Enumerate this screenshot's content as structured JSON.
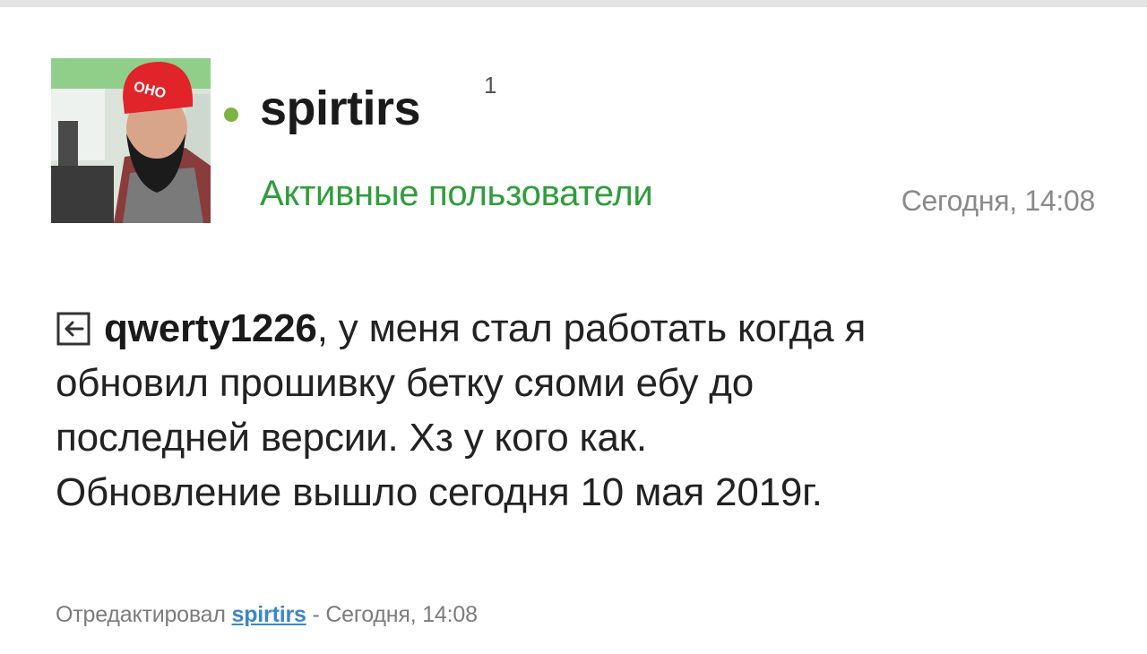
{
  "post": {
    "author": {
      "username": "spirtirs",
      "reputation": "1",
      "group": "Активные пользователи",
      "online": true,
      "avatar_hat_text": "OHO"
    },
    "timestamp": "Сегодня, 14:08",
    "body": {
      "mention": "qwerty1226",
      "line1_rest": ", у меня стал работать когда я",
      "line2": "обновил прошивку бетку сяоми ебу до",
      "line3": "последней версии. Хз у кого как.",
      "line4": "Обновление вышло сегодня 10 мая 2019г."
    },
    "edit_note": {
      "prefix": "Отредактировал",
      "editor": "spirtirs",
      "separator": "-",
      "time": "Сегодня, 14:08"
    }
  },
  "colors": {
    "group_green": "#2e9d3a",
    "online_green": "#7cb342",
    "link_blue": "#3c86c7",
    "hat_red": "#e0242a"
  },
  "icons": {
    "quote": "quote-arrow-icon"
  }
}
